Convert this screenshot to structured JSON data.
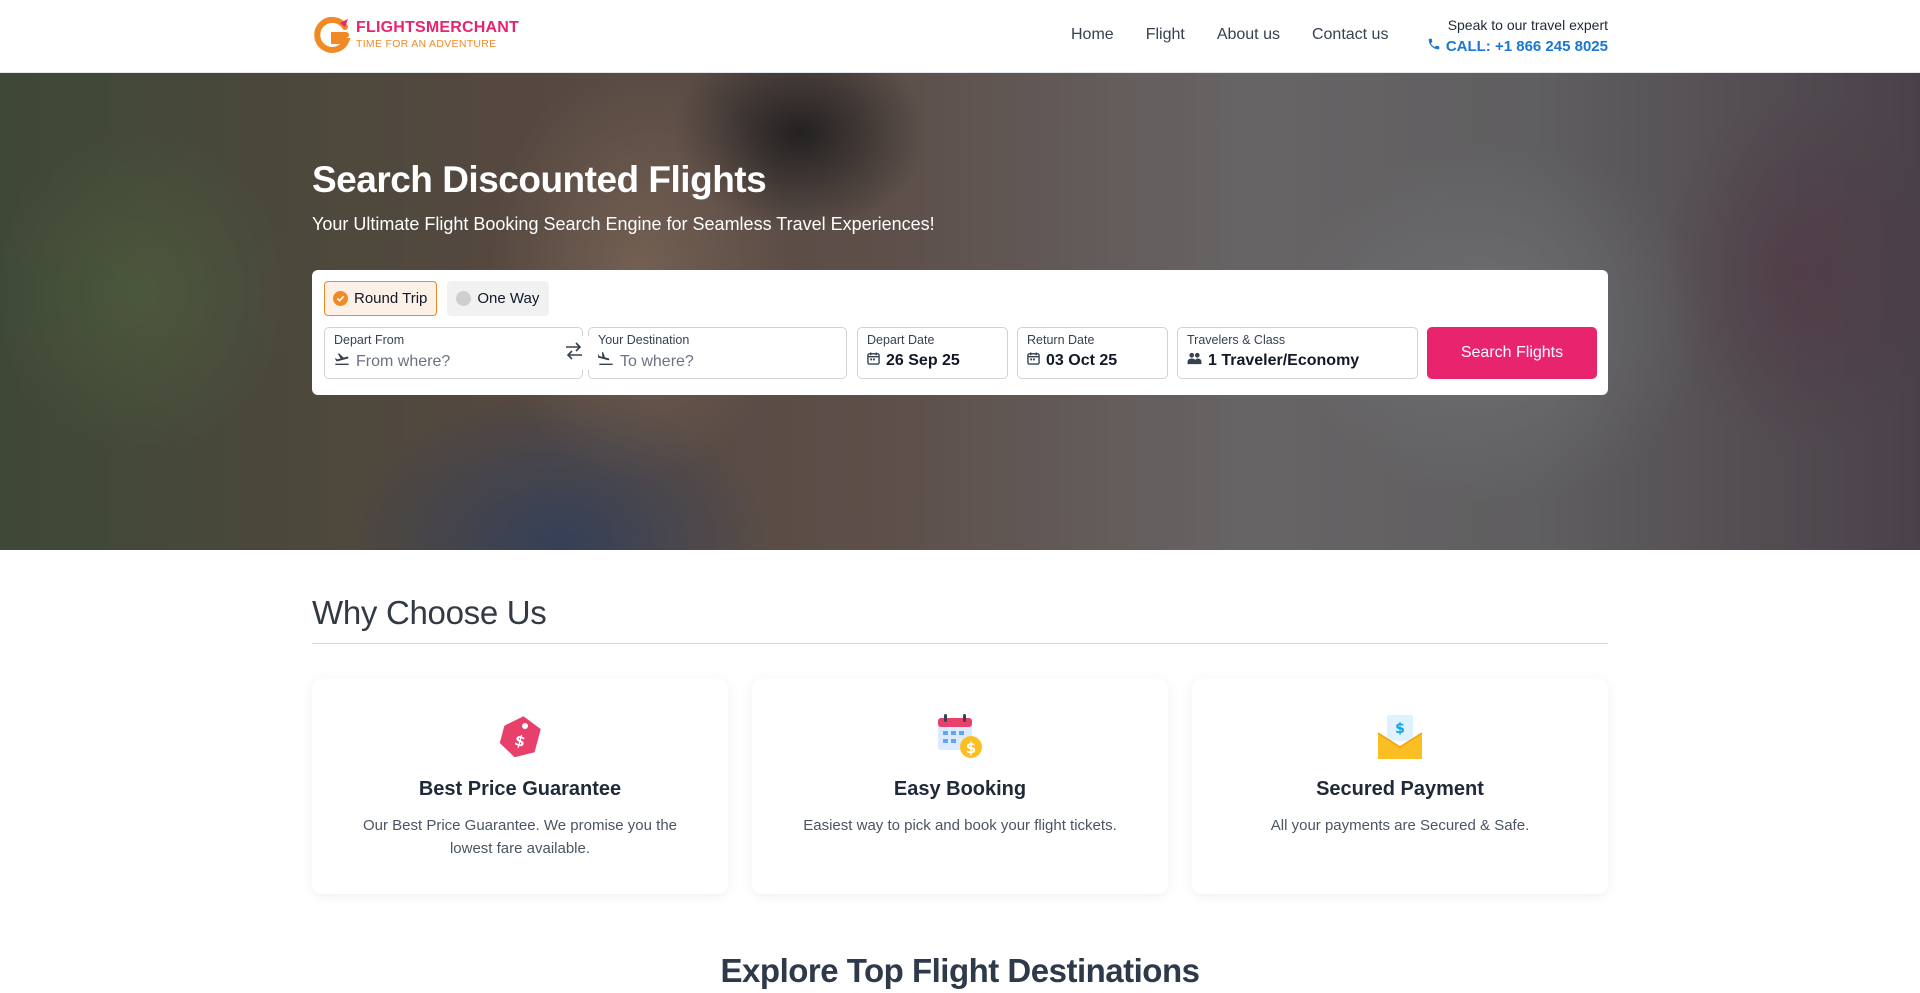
{
  "brand": {
    "name": "FLIGHTSMERCHANT",
    "tagline": "TIME FOR AN ADVENTURE",
    "primary_color": "#e8246f",
    "accent_color": "#f08a24",
    "link_color": "#1877d6"
  },
  "nav": {
    "items": [
      "Home",
      "Flight",
      "About us",
      "Contact us"
    ]
  },
  "contact": {
    "label": "Speak to our travel expert",
    "phone": "CALL: +1 866 245 8025",
    "icon": "phone-icon"
  },
  "hero": {
    "title": "Search Discounted Flights",
    "subtitle": "Your Ultimate Flight Booking Search Engine for Seamless Travel Experiences!"
  },
  "search": {
    "trip_types": [
      {
        "label": "Round Trip",
        "selected": true
      },
      {
        "label": "One Way",
        "selected": false
      }
    ],
    "depart_from": {
      "label": "Depart From",
      "placeholder": "From where?",
      "icon": "takeoff-icon"
    },
    "destination": {
      "label": "Your Destination",
      "placeholder": "To where?",
      "icon": "landing-icon"
    },
    "depart_date": {
      "label": "Depart Date",
      "value": "26 Sep 25",
      "icon": "calendar-icon"
    },
    "return_date": {
      "label": "Return Date",
      "value": "03 Oct 25",
      "icon": "calendar-icon"
    },
    "travelers": {
      "label": "Travelers & Class",
      "value": "1 Traveler/Economy",
      "icon": "users-icon"
    },
    "swap_icon": "swap-arrows-icon",
    "button": "Search Flights"
  },
  "why": {
    "title": "Why Choose Us",
    "features": [
      {
        "title": "Best Price Guarantee",
        "desc": "Our Best Price Guarantee. We promise you the lowest fare available.",
        "icon": "price-tag-icon"
      },
      {
        "title": "Easy Booking",
        "desc": "Easiest way to pick and book your flight tickets.",
        "icon": "calendar-money-icon"
      },
      {
        "title": "Secured Payment",
        "desc": "All your payments are Secured & Safe.",
        "icon": "secure-envelope-icon"
      }
    ]
  },
  "explore": {
    "title": "Explore Top Flight Destinations"
  }
}
